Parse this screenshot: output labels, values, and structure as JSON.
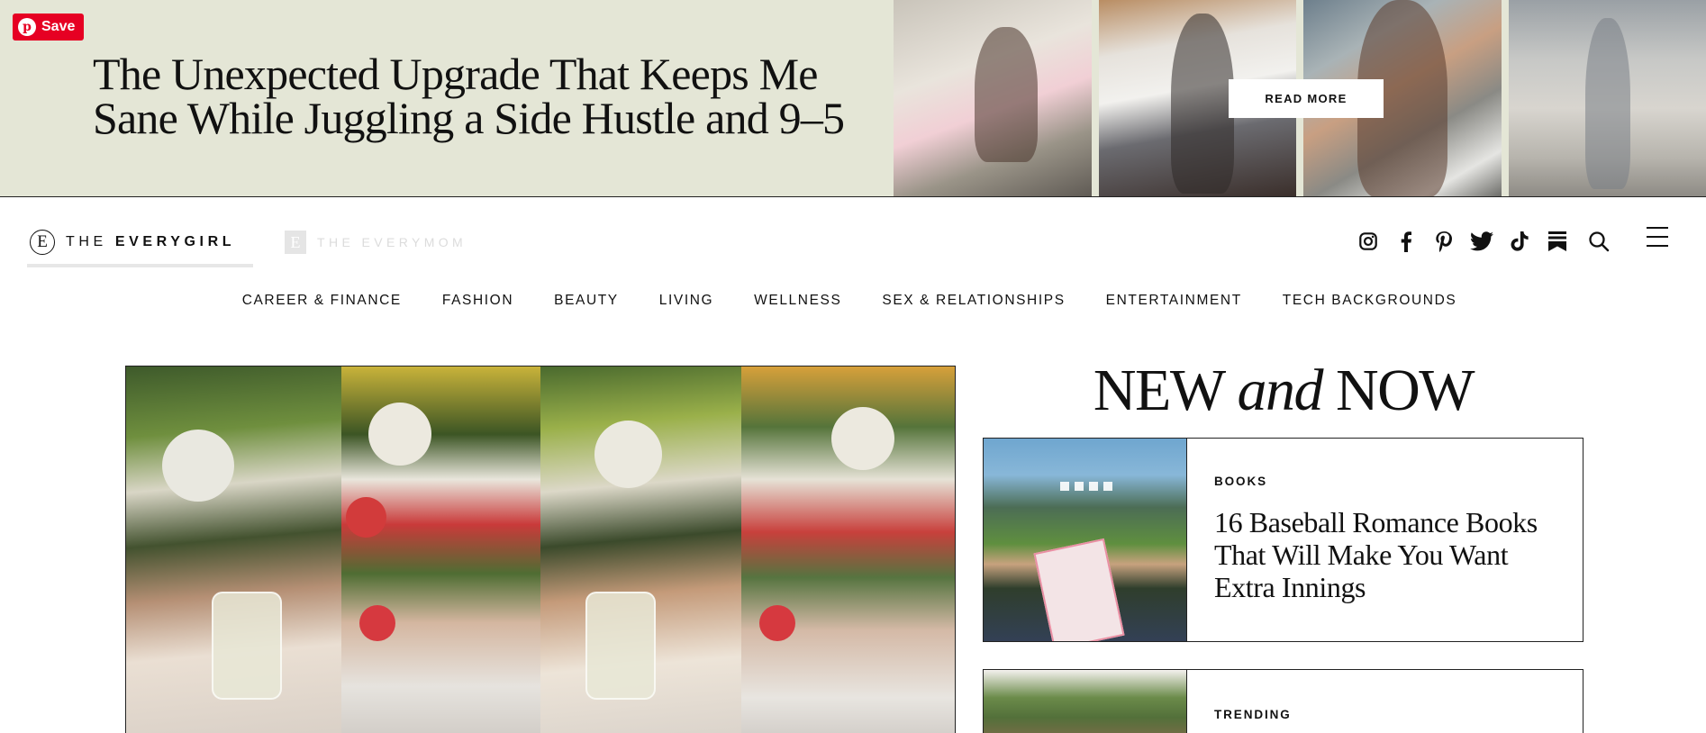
{
  "banner": {
    "save_label": "Save",
    "pin_logo_letter": "p",
    "headline": "The Unexpected Upgrade That Keeps Me Sane While Juggling a Side Hustle and 9–5",
    "read_more_label": "READ MORE"
  },
  "header": {
    "logo_primary_letter": "E",
    "logo_primary_prefix": "THE",
    "logo_primary_name": "EVERYGIRL",
    "logo_secondary_letter": "E",
    "logo_secondary_text": "THE EVERYMOM",
    "social_icons": [
      "instagram-icon",
      "facebook-icon",
      "pinterest-icon",
      "twitter-icon",
      "tiktok-icon",
      "substack-icon",
      "search-icon",
      "menu-icon"
    ]
  },
  "nav": {
    "items": [
      "CAREER & FINANCE",
      "FASHION",
      "BEAUTY",
      "LIVING",
      "WELLNESS",
      "SEX & RELATIONSHIPS",
      "ENTERTAINMENT",
      "TECH BACKGROUNDS"
    ]
  },
  "sidebar": {
    "title_part1": "NEW",
    "title_part2": "and",
    "title_part3": "NOW",
    "cards": [
      {
        "category": "BOOKS",
        "title": "16 Baseball Romance Books That Will Make You Want Extra Innings"
      },
      {
        "category": "TRENDING",
        "title": ""
      }
    ]
  },
  "colors": {
    "banner_bg": "#e4e6d6",
    "pinterest_red": "#e60023",
    "text": "#111111"
  }
}
